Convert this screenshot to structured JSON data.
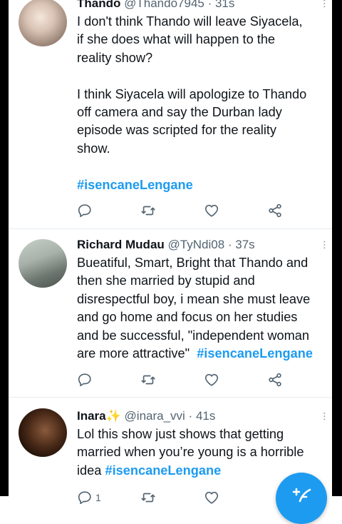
{
  "tweets": [
    {
      "display_name": "Thando",
      "handle_time": "@Thando7945 · 31s",
      "body_lines": [
        "I don't think Thando will leave Siyacela,",
        "if she does what will happen to the",
        "reality show?",
        "",
        "I think Siyacela will apologize to Thando",
        "off camera and say the Durban lady",
        "episode was scripted for the reality",
        "show."
      ],
      "hashtag": "#isencaneLengane"
    },
    {
      "display_name": "Richard Mudau",
      "handle_time": "@TyNdi08 · 37s",
      "body_lines": [
        "Bueatiful, Smart, Bright that Thando and",
        "then she married by stupid and",
        "disrespectful boy, i mean she must leave",
        "and go home and focus on her studies",
        "and be successful, \"independent woman"
      ],
      "last_line": "are more attractive\"",
      "hashtag": "#isencaneLengane"
    },
    {
      "display_name": "Inara",
      "name_emoji": "✨",
      "handle_time": "@inara_vvi · 41s",
      "body_lines": [
        "Lol this show just shows that getting",
        "married when you’re young is a horrible"
      ],
      "last_line": "idea",
      "hashtag": "#isencaneLengane",
      "reply_count": "1"
    }
  ],
  "icons": [
    "reply-icon",
    "retweet-icon",
    "like-icon",
    "share-icon",
    "more-icon",
    "compose-icon"
  ],
  "colors": {
    "accent": "#1d9bf0",
    "text": "#0f1419",
    "muted": "#536471"
  }
}
